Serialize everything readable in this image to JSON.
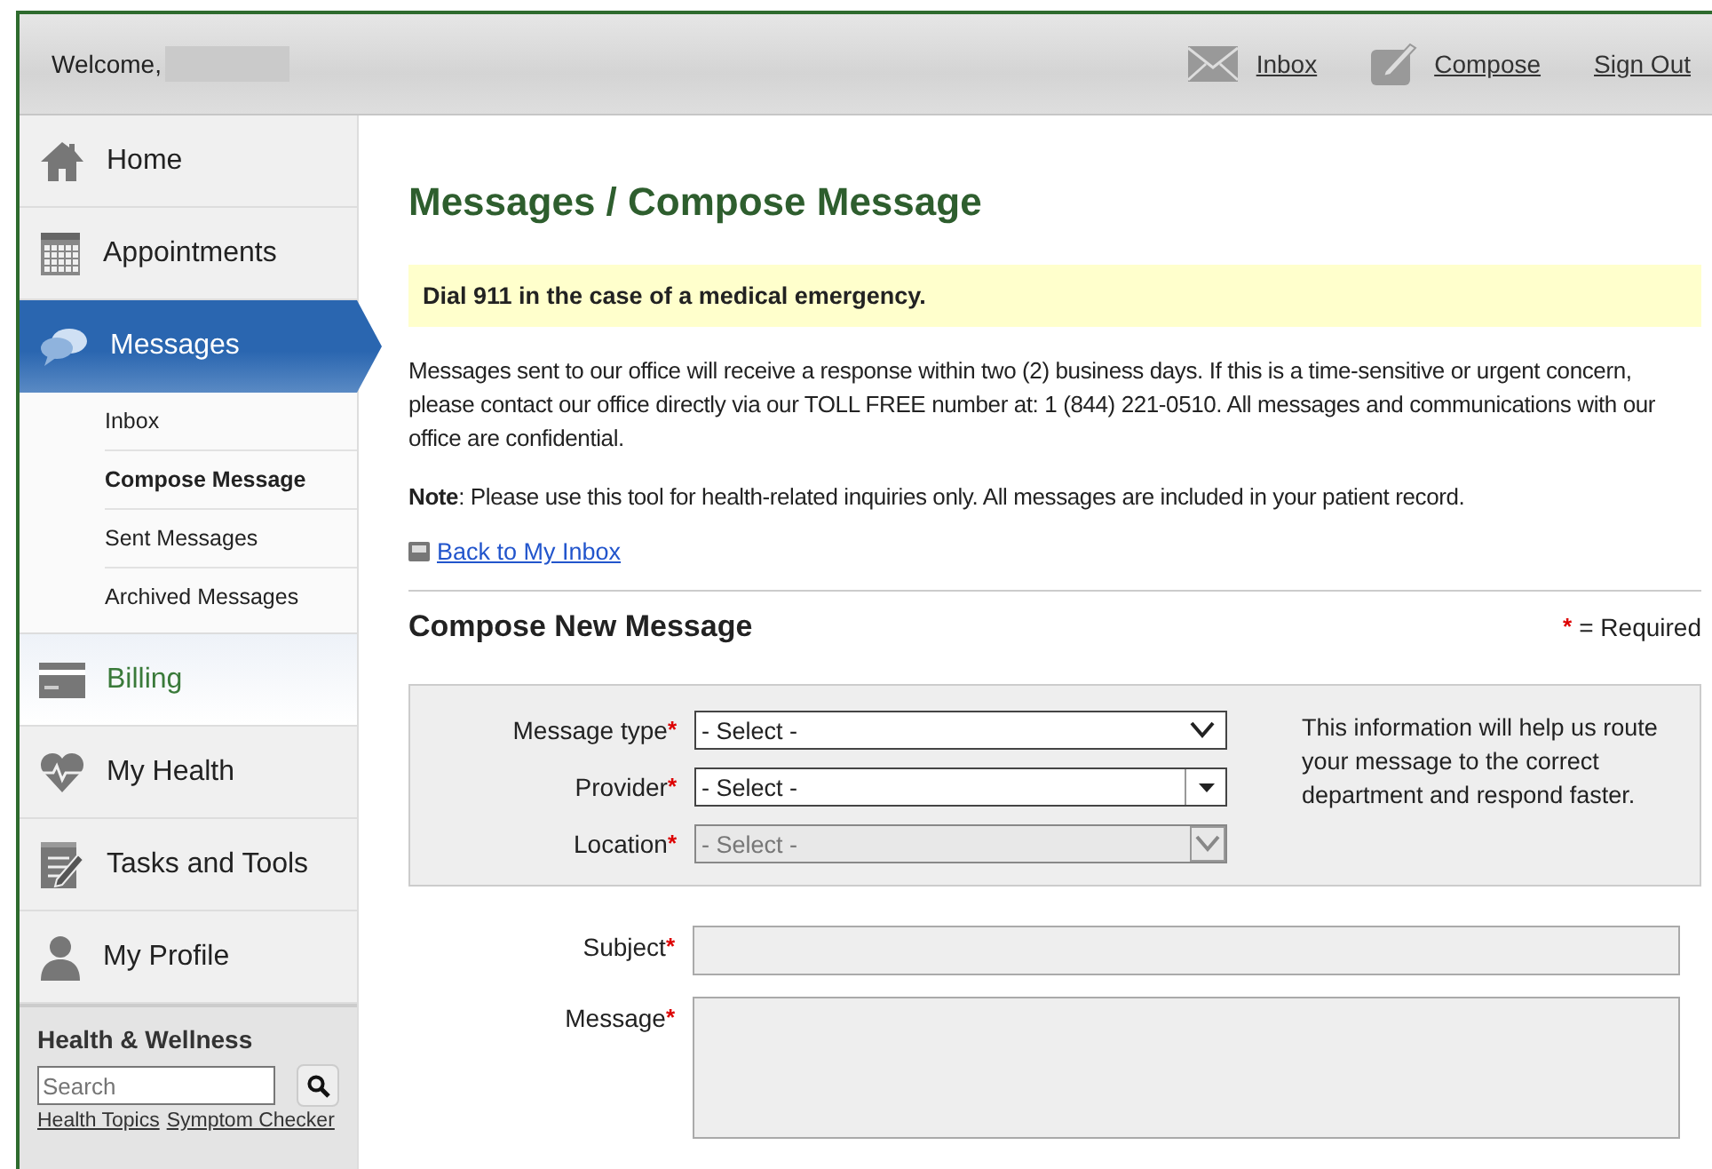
{
  "header": {
    "welcome": "Welcome,",
    "name_redacted": true,
    "links": [
      {
        "kind": "inbox",
        "label": "Inbox"
      },
      {
        "kind": "compose",
        "label": "Compose"
      },
      {
        "kind": "signout",
        "label": "Sign Out"
      }
    ]
  },
  "sidebar": {
    "items": [
      {
        "kind": "home",
        "label": "Home",
        "selected": false,
        "hovered": false
      },
      {
        "kind": "calendar",
        "label": "Appointments",
        "selected": false,
        "hovered": false
      },
      {
        "kind": "chat",
        "label": "Messages",
        "selected": true,
        "hovered": false,
        "children": [
          {
            "label": "Inbox",
            "selected": false
          },
          {
            "label": "Compose Message",
            "selected": true
          },
          {
            "label": "Sent Messages",
            "selected": false
          },
          {
            "label": "Archived Messages",
            "selected": false
          }
        ]
      },
      {
        "kind": "card",
        "label": "Billing",
        "selected": false,
        "hovered": true
      },
      {
        "kind": "heart",
        "label": "My Health",
        "selected": false,
        "hovered": false
      },
      {
        "kind": "notepad",
        "label": "Tasks and Tools",
        "selected": false,
        "hovered": false
      },
      {
        "kind": "person",
        "label": "My Profile",
        "selected": false,
        "hovered": false
      }
    ],
    "wellness": {
      "title": "Health & Wellness",
      "search": {
        "placeholder": "Search"
      },
      "links": [
        "Health Topics",
        "Symptom Checker"
      ]
    }
  },
  "main": {
    "title": "Messages / Compose Message",
    "alert": "Dial 911 in the case of a medical emergency.",
    "intro": "Messages sent to our office will receive a response within two (2) business days. If this is a time-sensitive or urgent concern, please contact our office directly via our TOLL FREE number at: 1 (844) 221-0510. All messages and communications with our office are confidential.",
    "note": "**Note**: Please use this tool for health-related inquiries only. All messages are included in your patient record.",
    "back_link": "Back to My Inbox",
    "section_title": "Compose New Message",
    "required_legend": {
      "mark": "*",
      "text": "= Required"
    },
    "routing": {
      "help": "This information will help us route your message to the correct department and respond faster.",
      "fields": [
        {
          "kind": "select",
          "label": "Message type",
          "required_mark": "*",
          "value": "- Select -",
          "disabled": false
        },
        {
          "kind": "combo",
          "label": "Provider",
          "required_mark": "*",
          "value": "- Select -",
          "disabled": false
        },
        {
          "kind": "select",
          "label": "Location",
          "required_mark": "*",
          "value": "- Select -",
          "disabled": true
        }
      ]
    },
    "fields": [
      {
        "kind": "text",
        "label": "Subject",
        "required_mark": "*"
      },
      {
        "kind": "textarea",
        "label": "Message",
        "required_mark": "*"
      }
    ]
  }
}
